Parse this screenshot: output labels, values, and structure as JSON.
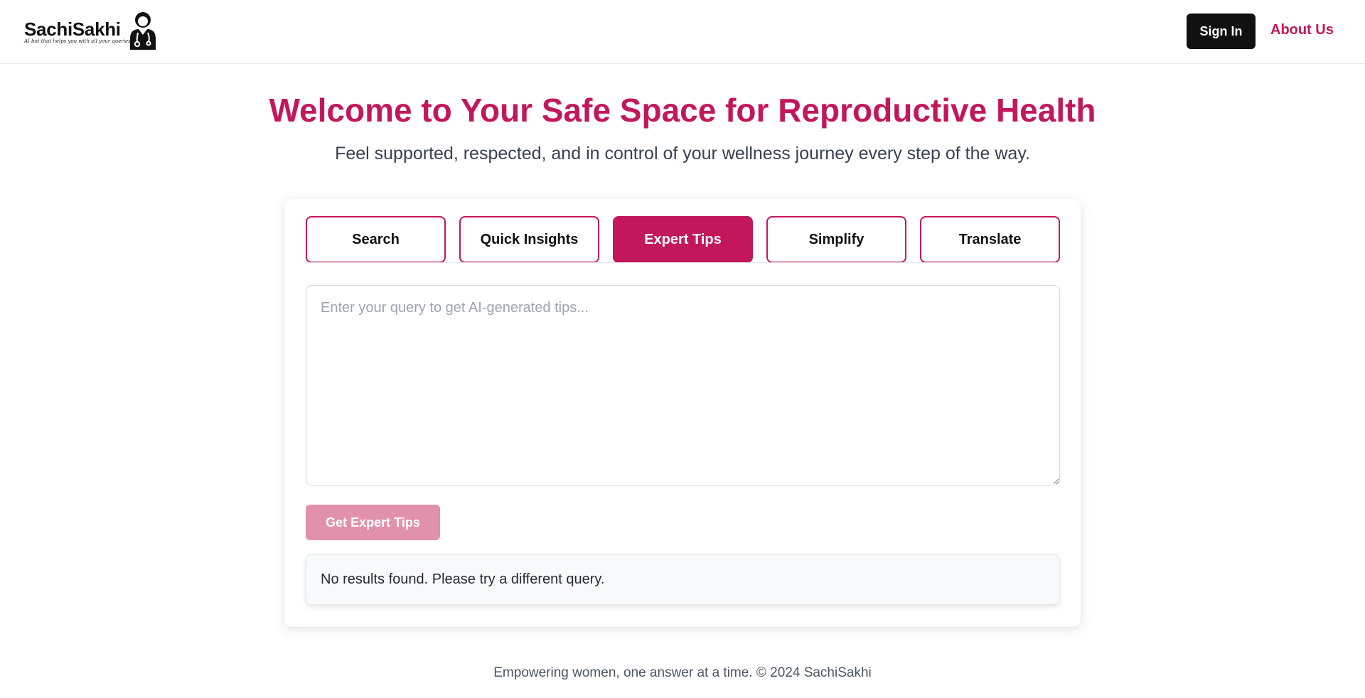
{
  "header": {
    "logo_name": "SachiSakhi",
    "logo_tagline": "AI bot that helps you with all your queries",
    "logo_icon": "doctor-avatar-icon",
    "signin_label": "Sign In",
    "about_label": "About Us"
  },
  "hero": {
    "title": "Welcome to Your Safe Space for Reproductive Health",
    "subtitle": "Feel supported, respected, and in control of your wellness journey every step of the way."
  },
  "tabs": [
    {
      "label": "Search",
      "active": false
    },
    {
      "label": "Quick Insights",
      "active": false
    },
    {
      "label": "Expert Tips",
      "active": true
    },
    {
      "label": "Simplify",
      "active": false
    },
    {
      "label": "Translate",
      "active": false
    }
  ],
  "query": {
    "placeholder": "Enter your query to get AI-generated tips...",
    "value": ""
  },
  "action": {
    "button_label": "Get Expert Tips"
  },
  "result": {
    "message": "No results found. Please try a different query."
  },
  "footer": {
    "text": "Empowering women, one answer at a time. © 2024 SachiSakhi"
  },
  "colors": {
    "brand": "#c2185b",
    "brand_light": "#e291ad",
    "dark_button": "#111111"
  }
}
